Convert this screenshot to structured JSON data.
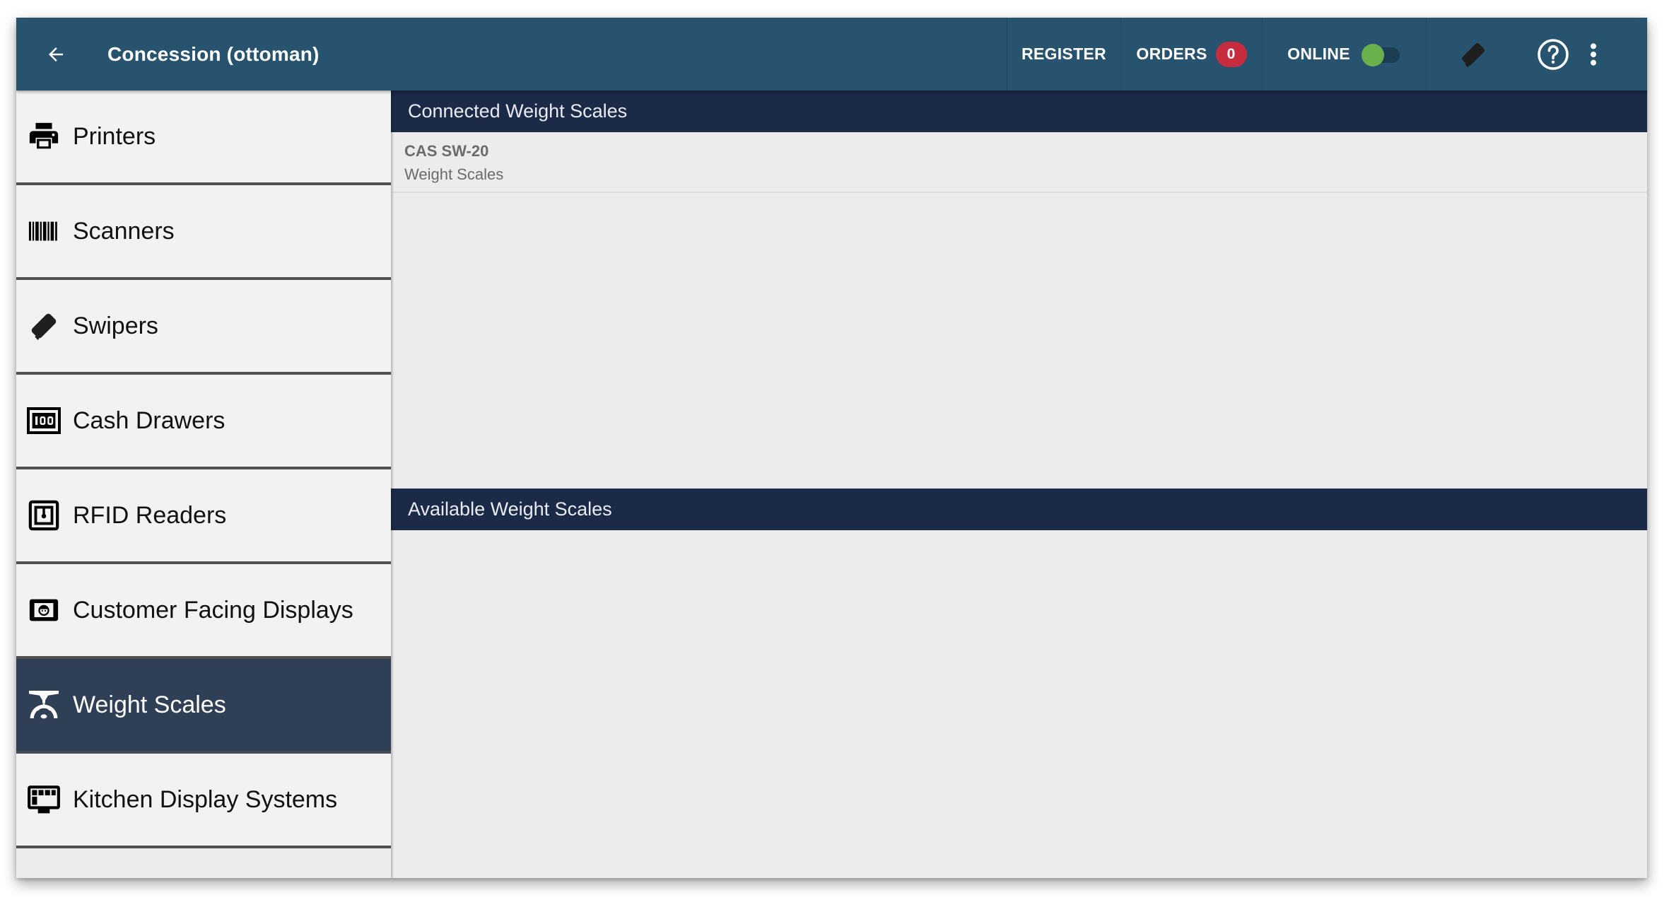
{
  "appbar": {
    "title": "Concession (ottoman)",
    "back_icon": "arrow-left-icon",
    "register_label": "REGISTER",
    "orders_label": "ORDERS",
    "orders_count": "0",
    "online_label": "ONLINE",
    "online_enabled": true,
    "swiper_icon": "card-swiper-icon",
    "help_icon": "help-circle-icon",
    "more_icon": "more-vert-icon",
    "colors": {
      "bar": "#27536f",
      "badge": "#c62c3d",
      "toggle_on": "#6ab04c"
    }
  },
  "sidebar": {
    "selected_index": 6,
    "items": [
      {
        "label": "Printers",
        "icon": "printer-icon"
      },
      {
        "label": "Scanners",
        "icon": "barcode-icon"
      },
      {
        "label": "Swipers",
        "icon": "card-swiper-icon"
      },
      {
        "label": "Cash Drawers",
        "icon": "cash-drawer-icon"
      },
      {
        "label": "RFID Readers",
        "icon": "rfid-icon"
      },
      {
        "label": "Customer Facing Displays",
        "icon": "customer-display-icon"
      },
      {
        "label": "Weight Scales",
        "icon": "weight-scale-icon"
      },
      {
        "label": "Kitchen Display Systems",
        "icon": "kitchen-display-icon"
      }
    ]
  },
  "main": {
    "connected": {
      "header": "Connected Weight Scales",
      "devices": [
        {
          "name": "CAS SW-20",
          "type": "Weight Scales"
        }
      ]
    },
    "available": {
      "header": "Available Weight Scales",
      "devices": []
    },
    "colors": {
      "section_header": "#1b2a47",
      "selected_item": "#2f3f55"
    }
  }
}
